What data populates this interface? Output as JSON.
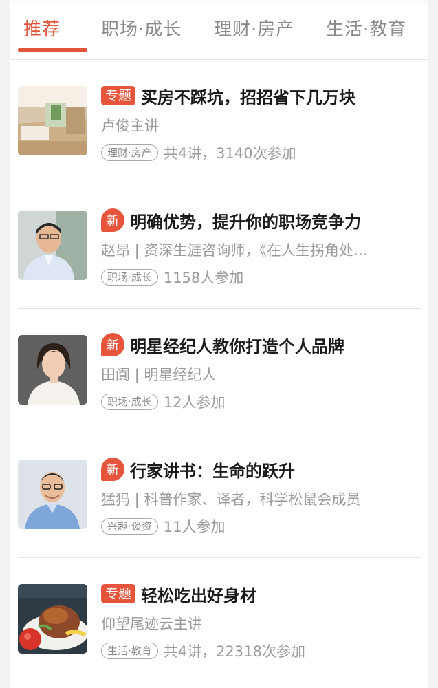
{
  "tabs": [
    "推荐",
    "职场·成长",
    "理财·房产",
    "生活·教育"
  ],
  "active_tab": 0,
  "colors": {
    "accent": "#e05438",
    "badge": "#e6553b"
  },
  "items": [
    {
      "badge": "专题",
      "badge_type": "special",
      "title": "买房不踩坑，招招省下几万块",
      "speaker": "卢俊主讲",
      "tag": "理财·房产",
      "participants": "共4讲，3140次参加"
    },
    {
      "badge": "新",
      "badge_type": "new",
      "title": "明确优势，提升你的职场竞争力",
      "speaker": "赵昂 | 资深生涯咨询师，《在人生拐角处…",
      "tag": "职场·成长",
      "participants": "1158人参加"
    },
    {
      "badge": "新",
      "badge_type": "new",
      "title": "明星经纪人教你打造个人品牌",
      "speaker": "田阗 | 明星经纪人",
      "tag": "职场·成长",
      "participants": "12人参加"
    },
    {
      "badge": "新",
      "badge_type": "new",
      "title": "行家讲书：生命的跃升",
      "speaker": "猛犸 | 科普作家、译者，科学松鼠会成员",
      "tag": "兴趣·谈资",
      "participants": "11人参加"
    },
    {
      "badge": "专题",
      "badge_type": "special",
      "title": "轻松吃出好身材",
      "speaker": "仰望尾迹云主讲",
      "tag": "生活·教育",
      "participants": "共4讲，22318次参加"
    }
  ]
}
